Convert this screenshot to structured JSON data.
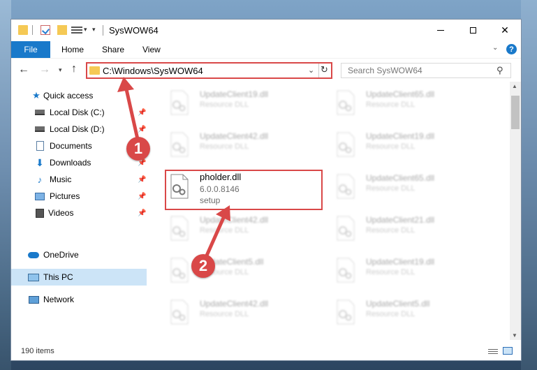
{
  "window": {
    "title": "SysWOW64",
    "minimize_label": "",
    "maximize_label": "",
    "close_label": "✕"
  },
  "ribbon": {
    "file_tab": "File",
    "tabs": [
      "Home",
      "Share",
      "View"
    ],
    "help": "?"
  },
  "navigation": {
    "address": "C:\\Windows\\SysWOW64",
    "search_placeholder": "Search SysWOW64"
  },
  "sidebar": {
    "items": [
      {
        "label": "Quick access",
        "icon": "star-icon",
        "pinned": false
      },
      {
        "label": "Local Disk (C:)",
        "icon": "drive-icon",
        "pinned": true
      },
      {
        "label": "Local Disk (D:)",
        "icon": "drive-icon",
        "pinned": true
      },
      {
        "label": "Documents",
        "icon": "documents-icon",
        "pinned": true
      },
      {
        "label": "Downloads",
        "icon": "download-icon",
        "pinned": true
      },
      {
        "label": "Music",
        "icon": "music-icon",
        "pinned": true
      },
      {
        "label": "Pictures",
        "icon": "pictures-icon",
        "pinned": true
      },
      {
        "label": "Videos",
        "icon": "videos-icon",
        "pinned": true
      },
      {
        "label": "OneDrive",
        "icon": "onedrive-icon",
        "pinned": false
      },
      {
        "label": "This PC",
        "icon": "this-pc-icon",
        "pinned": false,
        "selected": true
      },
      {
        "label": "Network",
        "icon": "network-icon",
        "pinned": false
      }
    ]
  },
  "files": {
    "left": [
      {
        "name": "UpdateClient19.dll",
        "type": "Resource DLL"
      },
      {
        "name": "UpdateClient42.dll",
        "type": "Resource DLL"
      },
      {
        "name": "UpdateClient42.dll",
        "type": "Resource DLL"
      },
      {
        "name": "UpdateClient5.dll",
        "type": "Resource DLL"
      },
      {
        "name": "UpdateClient42.dll",
        "type": "Resource DLL"
      }
    ],
    "right": [
      {
        "name": "UpdateClient65.dll",
        "type": "Resource DLL"
      },
      {
        "name": "UpdateClient19.dll",
        "type": "Resource DLL"
      },
      {
        "name": "UpdateClient65.dll",
        "type": "Resource DLL"
      },
      {
        "name": "UpdateClient21.dll",
        "type": "Resource DLL"
      },
      {
        "name": "UpdateClient19.dll",
        "type": "Resource DLL"
      },
      {
        "name": "UpdateClient5.dll",
        "type": "Resource DLL"
      }
    ],
    "highlighted": {
      "name": "pholder.dll",
      "version": "6.0.0.8146",
      "description": "setup"
    }
  },
  "status": {
    "item_count": "190 items"
  },
  "callouts": [
    "1",
    "2"
  ],
  "colors": {
    "accent": "#1979ca",
    "highlight_red": "#d94848",
    "selected_bg": "#cce4f7"
  }
}
